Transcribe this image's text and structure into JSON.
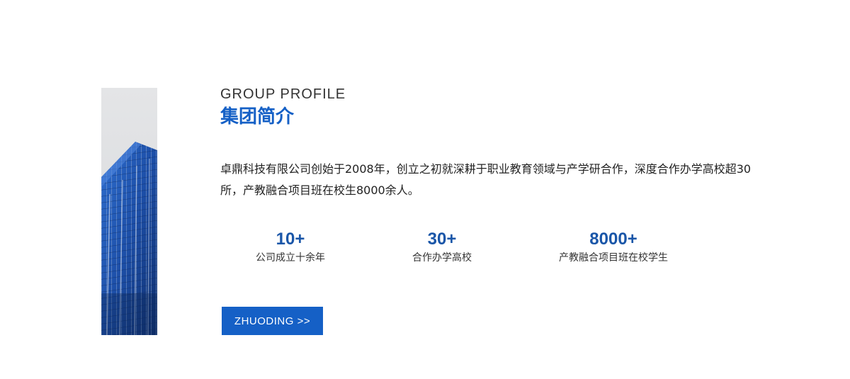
{
  "header": {
    "subtitle": "GROUP PROFILE",
    "title": "集团简介"
  },
  "profile": {
    "description": "卓鼎科技有限公司创始于2008年，创立之初就深耕于职业教育领域与产学研合作，深度合作办学高校超30所，产教融合项目班在校生8000余人。"
  },
  "stats": [
    {
      "value": "10+",
      "label": "公司成立十余年"
    },
    {
      "value": "30+",
      "label": "合作办学高校"
    },
    {
      "value": "8000+",
      "label": "产教融合项目班在校学生"
    }
  ],
  "cta": {
    "label": "ZHUODING >>"
  },
  "colors": {
    "accent": "#1560c6",
    "stat_value": "#1a56a8",
    "text": "#222222"
  }
}
